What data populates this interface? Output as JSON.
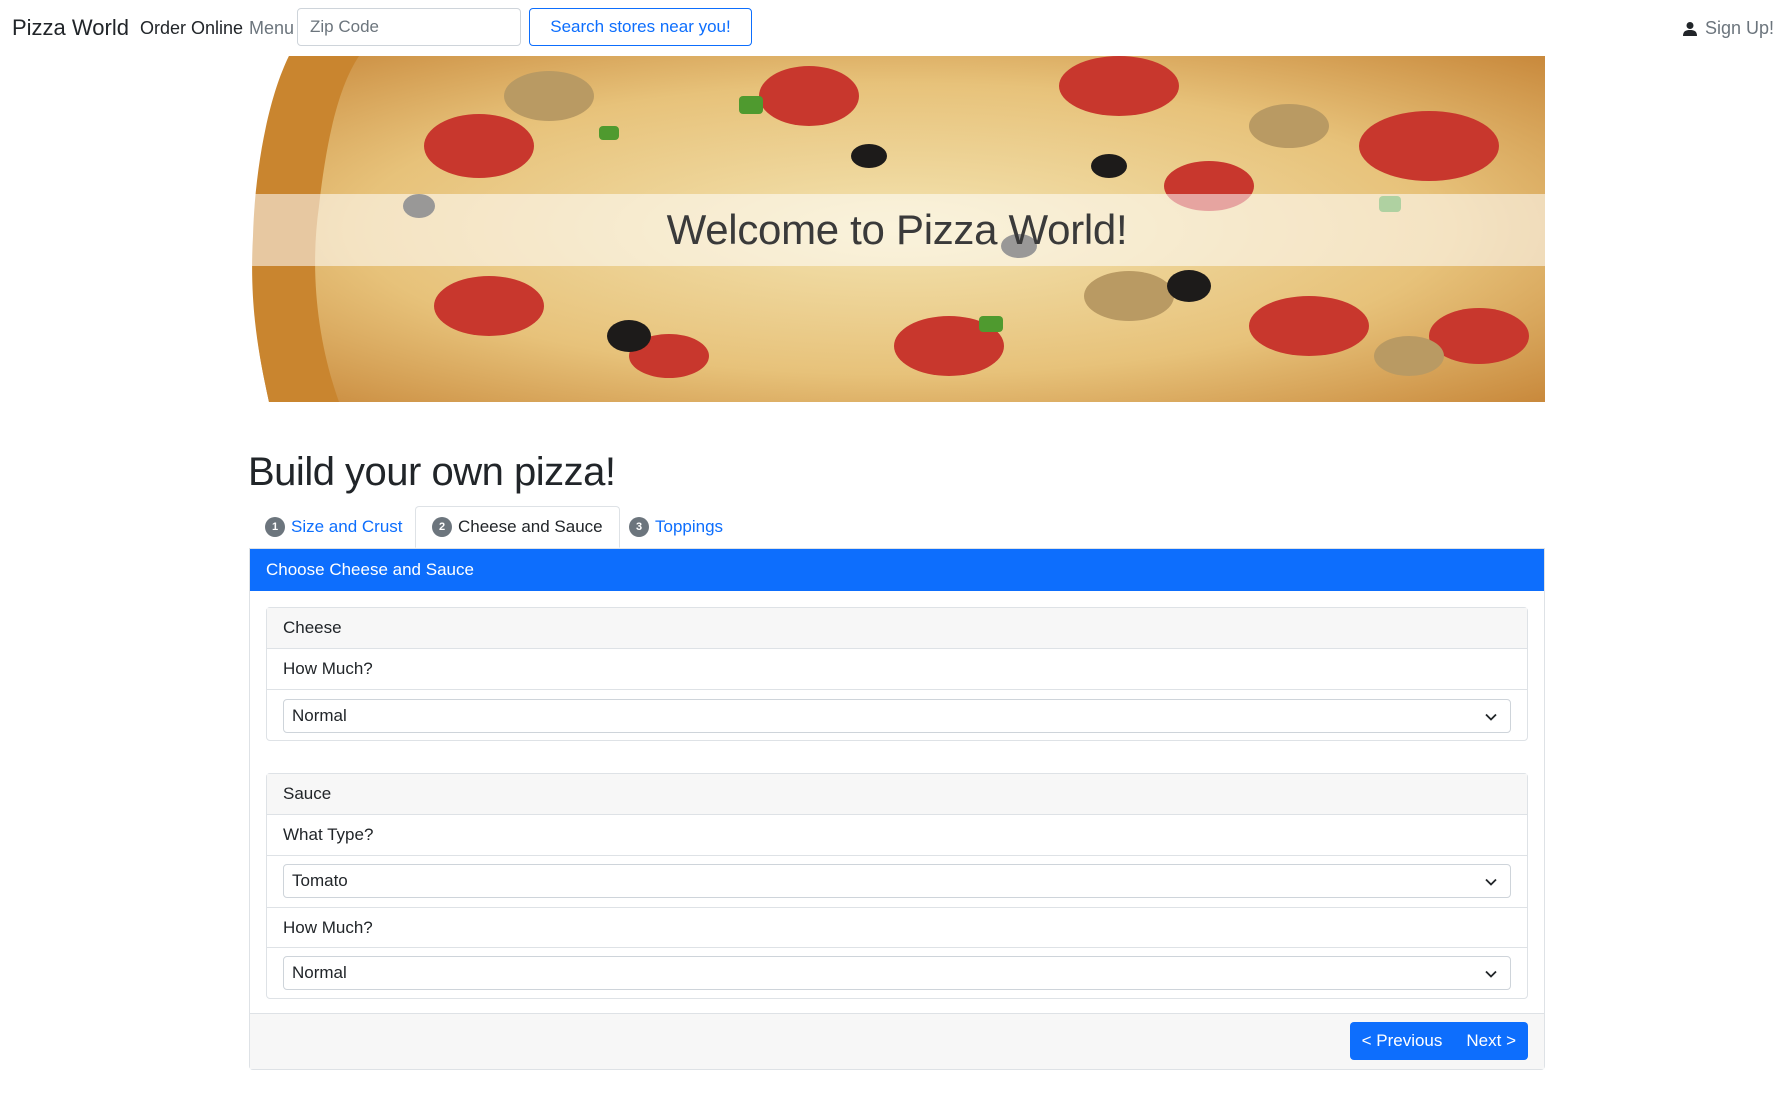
{
  "navbar": {
    "brand": "Pizza World",
    "order_online": "Order Online",
    "menu": "Menu",
    "zip_placeholder": "Zip Code",
    "search_button": "Search stores near you!",
    "signup": "Sign Up!"
  },
  "hero": {
    "title": "Welcome to Pizza World!"
  },
  "builder": {
    "title": "Build your own pizza!",
    "tabs": [
      {
        "num": "1",
        "label": "Size and Crust"
      },
      {
        "num": "2",
        "label": "Cheese and Sauce"
      },
      {
        "num": "3",
        "label": "Toppings"
      }
    ],
    "card_header": "Choose Cheese and Sauce",
    "cheese": {
      "title": "Cheese",
      "amount_label": "How Much?",
      "amount_value": "Normal"
    },
    "sauce": {
      "title": "Sauce",
      "type_label": "What Type?",
      "type_value": "Tomato",
      "amount_label": "How Much?",
      "amount_value": "Normal"
    },
    "prev_button": "< Previous",
    "next_button": "Next >"
  },
  "colors": {
    "primary": "#0d6efd",
    "muted": "#6c757d",
    "border": "#dee2e6"
  }
}
